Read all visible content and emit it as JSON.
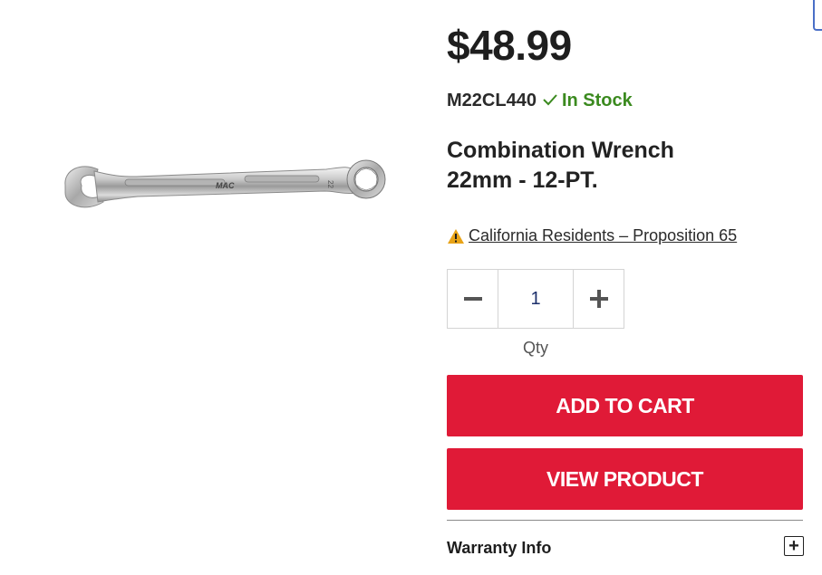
{
  "product": {
    "price": "$48.99",
    "sku": "M22CL440",
    "stock_status": "In Stock",
    "title_line1": "Combination Wrench",
    "title_line2": "22mm - 12-PT.",
    "image_icon": "combination-wrench-image"
  },
  "notice": {
    "prop65_text": "California Residents – Proposition 65",
    "icon": "warning-triangle-icon"
  },
  "quantity": {
    "value": "1",
    "label": "Qty",
    "minus_icon": "minus-icon",
    "plus_icon": "plus-icon"
  },
  "actions": {
    "add_to_cart": "ADD TO CART",
    "view_product": "VIEW PRODUCT"
  },
  "accordion": {
    "warranty_label": "Warranty Info",
    "toggle_symbol": "+"
  },
  "colors": {
    "accent_red": "#e01a37",
    "in_stock_green": "#3b8a1f",
    "warning_amber": "#e8a317"
  }
}
